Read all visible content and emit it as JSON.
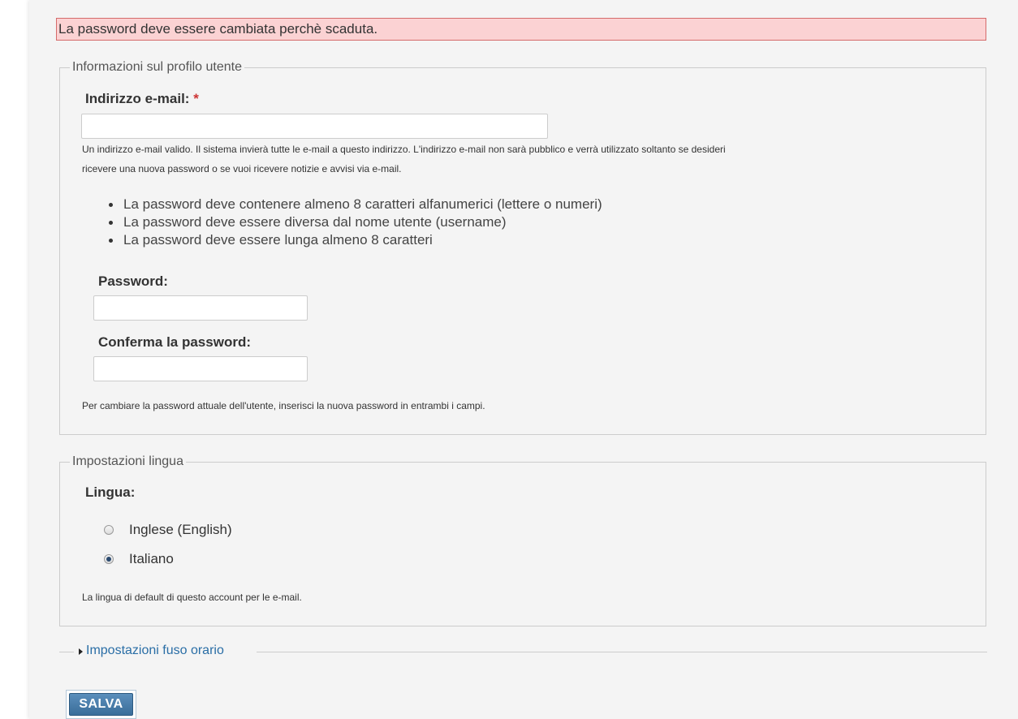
{
  "error_message": "La password deve essere cambiata perchè scaduta.",
  "profile": {
    "legend": "Informazioni sul profilo utente",
    "email_label": "Indirizzo e-mail:",
    "required_mark": "*",
    "email_value": "",
    "email_desc_line1": "Un indirizzo e-mail valido. Il sistema invierà tutte le e-mail a questo indirizzo. L'indirizzo e-mail non sarà pubblico e verrà utilizzato soltanto se desideri",
    "email_desc_line2": "ricevere una nuova password o se vuoi ricevere notizie e avvisi via e-mail.",
    "rules": [
      "La password deve contenere almeno 8 caratteri alfanumerici (lettere o numeri)",
      "La password deve essere diversa dal nome utente (username)",
      "La password deve essere lunga almeno 8 caratteri"
    ],
    "password_label": "Password:",
    "password_value": "",
    "confirm_label": "Conferma la password:",
    "confirm_value": "",
    "password_desc": "Per cambiare la password attuale dell'utente, inserisci la nuova password in entrambi i campi."
  },
  "language": {
    "legend": "Impostazioni lingua",
    "label": "Lingua:",
    "options": [
      {
        "label": "Inglese (English)",
        "checked": false
      },
      {
        "label": "Italiano",
        "checked": true
      }
    ],
    "desc": "La lingua di default di questo account per le e-mail."
  },
  "timezone": {
    "legend": "Impostazioni fuso orario"
  },
  "save_label": "SALVA",
  "colors": {
    "error_bg": "#fbd2d3",
    "error_border": "#d56b6b",
    "link": "#2a6ea6",
    "button": "#3a6d99"
  }
}
